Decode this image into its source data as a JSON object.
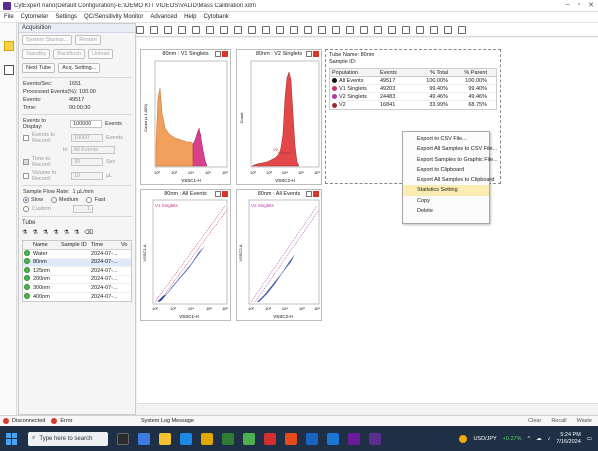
{
  "window": {
    "title": "CytExpert nano(Default Configuration)-E:\\DEMO KIT VIDEOS\\VALID\\Mass Calibration.xitm"
  },
  "menu": [
    "File",
    "Cytometer",
    "Settings",
    "QC/Sensitivity Monitor",
    "Advanced",
    "Help",
    "Cytobank"
  ],
  "acquisition": {
    "header": "Acquisition",
    "system_startup": "System Startup...",
    "restart": "Restart",
    "standby": "Standby",
    "backflush": "Backflush",
    "unload": "Unload",
    "next_tube": "Next Tube",
    "acq_setting": "Acq. Setting..."
  },
  "stats": [
    {
      "k": "Events/Sec:",
      "v": "1651"
    },
    {
      "k": "Processed Events(%):",
      "v": "100.00"
    },
    {
      "k": "Events:",
      "v": "49517"
    },
    {
      "k": "Time:",
      "v": "00:00:30"
    }
  ],
  "events_to_display": {
    "label": "Events to Display:",
    "value": "100000",
    "unit": "Events"
  },
  "events_to_record": {
    "label": "Events to Record:",
    "value": "10000",
    "unit": "Events"
  },
  "in": {
    "label": "In",
    "value": "All Events"
  },
  "time_to_record": {
    "label": "Time to Record:",
    "value": "30",
    "unit": "Sec"
  },
  "volume_to_record": {
    "label": "Volume to Record:",
    "value": "10",
    "unit": "µL"
  },
  "flow_rate": {
    "label": "Sample Flow Rate:",
    "value": "1 µL/min",
    "options": [
      "Slow",
      "Medium",
      "Fast"
    ],
    "custom": "Custom",
    "custom_value": "1"
  },
  "tube_panel": {
    "header": "Tube",
    "columns": [
      "Name",
      "Sample ID",
      "Time",
      "Vo"
    ],
    "rows": [
      {
        "name": "Water",
        "time": "2024-07-..."
      },
      {
        "name": "80nm",
        "time": "2024-07-..."
      },
      {
        "name": "125nm",
        "time": "2024-07-..."
      },
      {
        "name": "200nm",
        "time": "2024-07-..."
      },
      {
        "name": "300nm",
        "time": "2024-07-..."
      },
      {
        "name": "400nm",
        "time": "2024-07-..."
      }
    ]
  },
  "plots": {
    "hist1": {
      "title": "80nm : V1 Singlets",
      "ylabel": "Count (x 1,000)",
      "xlabel": "VSSC1-H",
      "gate": "V1",
      "y_ticks": [
        "1.2",
        "1.0",
        "0.8",
        "0.6",
        "0.4",
        "0.2",
        "0"
      ]
    },
    "hist2": {
      "title": "80nm : V2 Singlets",
      "ylabel": "Count",
      "xlabel": "VSSC2-H",
      "gate": "V2",
      "y_ticks": [
        "700",
        "600",
        "500",
        "400",
        "300",
        "200",
        "100",
        "0"
      ]
    },
    "dot1": {
      "title": "80nm : All Events",
      "gate": "V1 Singlets",
      "xlabel": "VSSC1-H",
      "ylabel": "VSSC1-A"
    },
    "dot2": {
      "title": "80nm : All Events",
      "gate": "V2 Singlets",
      "xlabel": "VSSC2-H",
      "ylabel": "VSSC2-A"
    },
    "x_ticks": [
      "10²",
      "10³",
      "10⁴",
      "10⁵",
      "10⁶"
    ]
  },
  "stat_window": {
    "tube_name_label": "Tube Name:",
    "tube_name": "80nm",
    "sample_id_label": "Sample ID:",
    "columns": [
      "Population",
      "Events",
      "% Total",
      "% Parent"
    ],
    "rows": [
      {
        "pop": "All Events",
        "events": "49517",
        "total": "100.00%",
        "parent": "100.00%",
        "color": "#111111"
      },
      {
        "pop": "V1 Singlets",
        "events": "49203",
        "total": "99.40%",
        "parent": "99.40%",
        "color": "#c7317a"
      },
      {
        "pop": "V2 Singlets",
        "events": "24483",
        "total": "49.46%",
        "parent": "49.46%",
        "color": "#b03aa8"
      },
      {
        "pop": "V2",
        "events": "16841",
        "total": "33.99%",
        "parent": "68.75%",
        "color": "#9e2a2a"
      }
    ]
  },
  "context_menu": [
    "Export to CSV File...",
    "Export All Samples to CSV File...",
    "Export Samples to Graphic File...",
    "Export to Clipboard",
    "Export All Samples to Clipboard",
    "Statistics Setting",
    "Copy",
    "Delete"
  ],
  "status": {
    "disconnected": "Disconnected",
    "error": "Error",
    "system_log": "System Log Message",
    "clear": "Clear",
    "recall": "Recall",
    "waste": "Waste"
  },
  "taskbar": {
    "search": "Type here to search",
    "ticker": "USD/JPY",
    "ticker_change": "+0.27%",
    "time": "5:24 PM",
    "date": "7/16/2024"
  }
}
